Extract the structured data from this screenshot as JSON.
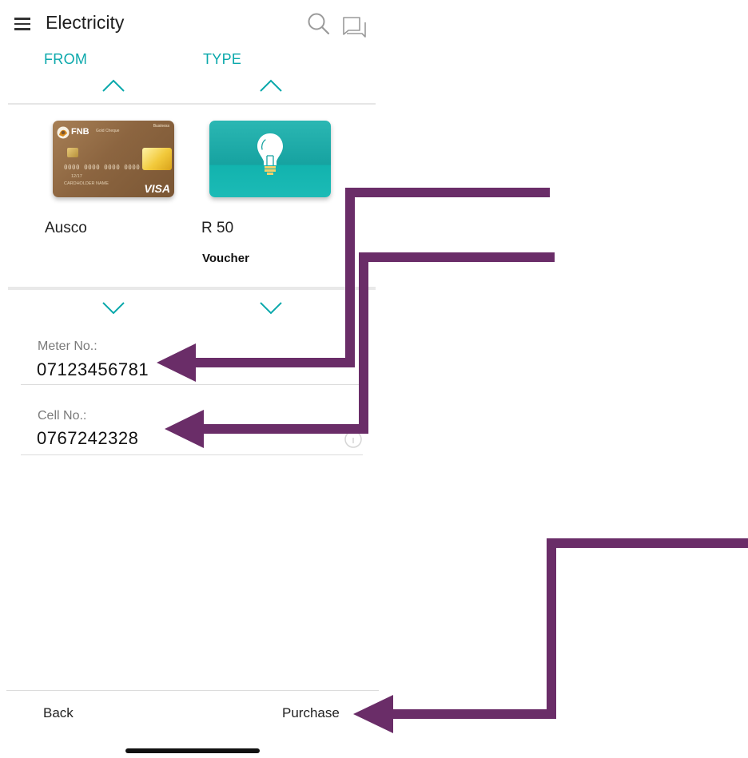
{
  "header": {
    "title": "Electricity",
    "icons": [
      "menu-icon",
      "search-icon",
      "chat-icon"
    ]
  },
  "columns": {
    "from_label": "FROM",
    "type_label": "TYPE"
  },
  "from_card": {
    "brand": "FNB",
    "tier": "Gold Cheque",
    "segment": "Business",
    "number": "0000 0000 0000 0000",
    "expiry": "12/17",
    "holder": "CARDHOLDER NAME",
    "network": "VISA",
    "account_name": "Ausco"
  },
  "type_card": {
    "icon": "lightbulb-icon",
    "amount": "R 50",
    "kind": "Voucher"
  },
  "fields": {
    "meter_label": "Meter No.:",
    "meter_value": "07123456781",
    "cell_label": "Cell No.:",
    "cell_value": "0767242328"
  },
  "footer": {
    "back_label": "Back",
    "purchase_label": "Purchase"
  },
  "colors": {
    "accent": "#0aa8ab",
    "annotation": "#6a2d68"
  }
}
